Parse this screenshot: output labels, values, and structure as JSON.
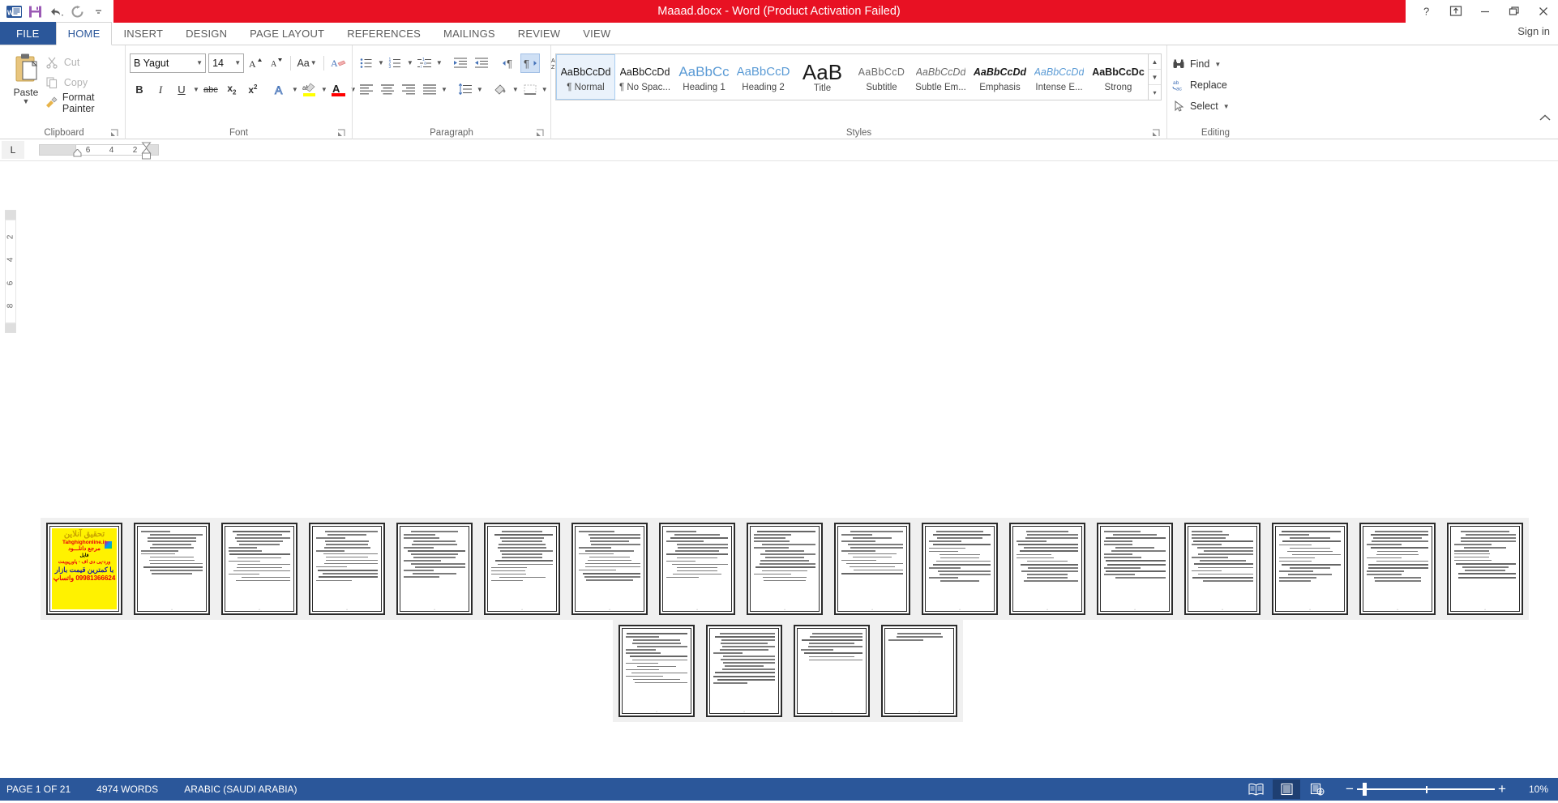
{
  "titlebar": {
    "document_title": "Maaad.docx  -  Word (Product Activation Failed)",
    "quick_access": [
      {
        "name": "word-logo-icon",
        "label": "W"
      },
      {
        "name": "save-icon",
        "label": "Save"
      },
      {
        "name": "undo-icon",
        "label": "Undo"
      },
      {
        "name": "redo-icon",
        "label": "Redo"
      },
      {
        "name": "customize-qat-icon",
        "label": "Customize Quick Access Toolbar"
      }
    ],
    "window_controls": [
      {
        "name": "help-button",
        "label": "?"
      },
      {
        "name": "ribbon-display-options-button",
        "label": "Ribbon Display Options"
      },
      {
        "name": "minimize-button",
        "label": "Minimize"
      },
      {
        "name": "restore-button",
        "label": "Restore Down"
      },
      {
        "name": "close-button",
        "label": "Close"
      }
    ]
  },
  "tabs": {
    "file_label": "FILE",
    "items": [
      {
        "label": "HOME",
        "active": true
      },
      {
        "label": "INSERT",
        "active": false
      },
      {
        "label": "DESIGN",
        "active": false
      },
      {
        "label": "PAGE LAYOUT",
        "active": false
      },
      {
        "label": "REFERENCES",
        "active": false
      },
      {
        "label": "MAILINGS",
        "active": false
      },
      {
        "label": "REVIEW",
        "active": false
      },
      {
        "label": "VIEW",
        "active": false
      }
    ],
    "sign_in_label": "Sign in"
  },
  "ribbon": {
    "clipboard": {
      "group_label": "Clipboard",
      "paste_label": "Paste",
      "cut_label": "Cut",
      "copy_label": "Copy",
      "format_painter_label": "Format Painter"
    },
    "font": {
      "group_label": "Font",
      "font_name": "B Yagut",
      "font_size": "14",
      "grow_font_label": "Grow Font",
      "shrink_font_label": "Shrink Font",
      "change_case_label": "Aa",
      "clear_formatting_label": "Clear All Formatting",
      "bold_label": "B",
      "italic_label": "I",
      "underline_label": "U",
      "strikethrough_label": "abc",
      "subscript_label": "x",
      "superscript_label": "x",
      "text_effects_label": "A",
      "highlight_label": "ab",
      "font_color_label": "A",
      "highlight_color": "#FFFF00",
      "font_color": "#FF0000"
    },
    "paragraph": {
      "group_label": "Paragraph",
      "bullets_label": "Bullets",
      "numbering_label": "Numbering",
      "multilevel_label": "Multilevel List",
      "decrease_indent_label": "Decrease Indent",
      "increase_indent_label": "Increase Indent",
      "ltr_label": "Left-to-Right Text Direction",
      "rtl_label": "Right-to-Left Text Direction",
      "sort_label": "Sort",
      "show_marks_label": "Show/Hide",
      "align_left_label": "Align Left",
      "center_label": "Center",
      "align_right_label": "Align Right",
      "justify_label": "Justify",
      "line_spacing_label": "Line and Paragraph Spacing",
      "shading_label": "Shading",
      "borders_label": "Borders",
      "rtl_active": true
    },
    "styles": {
      "group_label": "Styles",
      "items": [
        {
          "preview": "AaBbCcDd",
          "name": "¶ Normal",
          "selected": true,
          "style": "normal"
        },
        {
          "preview": "AaBbCcDd",
          "name": "¶ No Spac...",
          "selected": false,
          "style": "nospace"
        },
        {
          "preview": "AaBbCc",
          "name": "Heading 1",
          "selected": false,
          "style": "h1"
        },
        {
          "preview": "AaBbCcD",
          "name": "Heading 2",
          "selected": false,
          "style": "h2"
        },
        {
          "preview": "AaB",
          "name": "Title",
          "selected": false,
          "style": "title"
        },
        {
          "preview": "AaBbCcD",
          "name": "Subtitle",
          "selected": false,
          "style": "subtitle"
        },
        {
          "preview": "AaBbCcDd",
          "name": "Subtle Em...",
          "selected": false,
          "style": "subtle-em"
        },
        {
          "preview": "AaBbCcDd",
          "name": "Emphasis",
          "selected": false,
          "style": "emphasis"
        },
        {
          "preview": "AaBbCcDd",
          "name": "Intense E...",
          "selected": false,
          "style": "intense-em"
        },
        {
          "preview": "AaBbCcDc",
          "name": "Strong",
          "selected": false,
          "style": "strong"
        }
      ]
    },
    "editing": {
      "group_label": "Editing",
      "find_label": "Find",
      "replace_label": "Replace",
      "select_label": "Select"
    },
    "collapse_label": "Collapse the Ribbon"
  },
  "ruler": {
    "tab_stop_label": "L",
    "horizontal_marks": [
      "6",
      "4",
      "2"
    ],
    "vertical_marks": [
      "2",
      "4",
      "6",
      "8"
    ]
  },
  "document": {
    "cover_ad": {
      "line1": "تحقیق آنلاین",
      "line2": "Tahghighonline.ir",
      "line3": "مرجع دانلـــود",
      "line4": "فایل",
      "line5": "ورد-پی دی اف - پاورپوینت",
      "line6": "با کمترین قیمت بازار",
      "line7": "09981366624 واتساپ",
      "background_color": "#FFF200"
    },
    "row1_page_count": 17,
    "row2_page_count": 4,
    "row1_line_counts": [
      0,
      14,
      16,
      16,
      15,
      16,
      16,
      15,
      16,
      14,
      16,
      16,
      15,
      16,
      16,
      16,
      15
    ],
    "row2_line_counts": [
      16,
      16,
      9,
      3
    ]
  },
  "statusbar": {
    "page_label": "PAGE 1 OF 21",
    "words_label": "4974 WORDS",
    "language_label": "ARABIC (SAUDI ARABIA)",
    "views": [
      {
        "name": "read-mode-view-button",
        "active": false
      },
      {
        "name": "print-layout-view-button",
        "active": true
      },
      {
        "name": "web-layout-view-button",
        "active": false
      }
    ],
    "zoom_out_label": "−",
    "zoom_in_label": "+",
    "zoom_level": "10%"
  }
}
